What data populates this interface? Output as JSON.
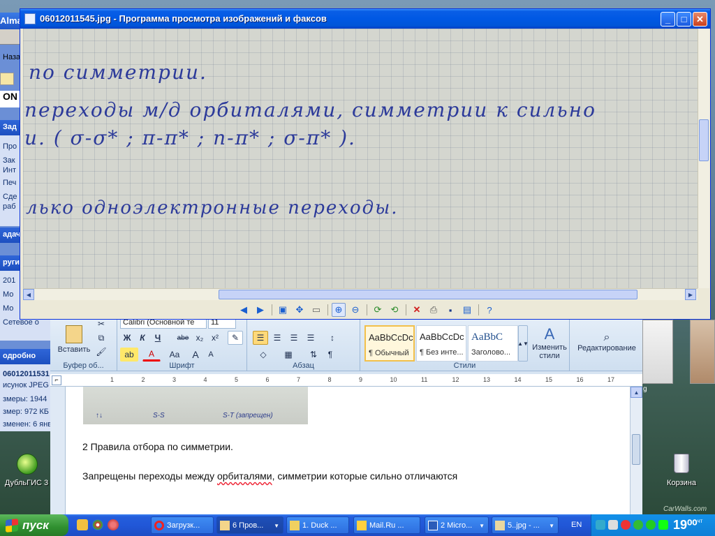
{
  "viewer": {
    "title": "06012011545.jpg - Программа просмотра изображений и факсов",
    "photo_lines": [
      "по симметрии.",
      "переходы м/д орбиталями, симметрии к сильно",
      "и. ( σ-σ* ; π-π* ; n-π* ; σ-π* ).",
      "лько одноэлектронные переходы."
    ]
  },
  "explorer": {
    "app_title": "Almap",
    "back_label": "Назад",
    "son": "ON",
    "tasks_header": "Зад",
    "task_items": [
      "Про",
      "Зак",
      "Инт",
      "Печ",
      "Сде",
      "раб"
    ],
    "tasks_header2": "адачи",
    "other_header": "ругие",
    "other_items": [
      "201",
      "Мо",
      "Мо",
      "Сетевое о"
    ],
    "detail_header": "одробно",
    "detail_name": "06012011531",
    "detail_type": "исунок JPEG",
    "detail_dims": "змеры: 1944",
    "detail_size": "змер: 972 КБ",
    "detail_changed": "зменен: 6 янв"
  },
  "word": {
    "ribbon": {
      "paste_label": "Вставить",
      "clipboard_group": "Буфер об...",
      "font_name": "Calibri (Основной те",
      "font_size": "11",
      "font_group": "Шрифт",
      "bold": "Ж",
      "italic": "К",
      "underline": "Ч",
      "strike": "abe",
      "subscript": "x₂",
      "superscript": "x²",
      "case": "Aa",
      "grow": "A",
      "shrink": "A",
      "paragraph_group": "Абзац",
      "styles_group": "Стили",
      "styles": [
        {
          "sample": "AaBbCcDc",
          "name": "¶ Обычный"
        },
        {
          "sample": "AaBbCcDc",
          "name": "¶ Без инте..."
        },
        {
          "sample": "AaBbC",
          "name": "Заголово..."
        }
      ],
      "change_styles": "Изменить стили",
      "editing": "Редактирование"
    },
    "ruler_marks": [
      "1",
      "2",
      "3",
      "4",
      "5",
      "6",
      "7",
      "8",
      "9",
      "10",
      "11",
      "12",
      "13",
      "14",
      "15",
      "16",
      "17"
    ],
    "snip_labels": [
      "S-S",
      "S-T (запрещен)"
    ],
    "doc_heading": "2 Правила отбора по симметрии.",
    "doc_line_before": "Запрещены переходы  между ",
    "doc_misspelled": "орбиталями",
    "doc_line_after": ", симметрии которые сильно отличаются"
  },
  "desktop": {
    "dubl_label": "ДубльГИС 3",
    "recycle_label": "Корзина",
    "watermark": "CarWalls.com",
    "thumb_caption": "g"
  },
  "taskbar": {
    "start_label": "пуск",
    "buttons": [
      {
        "label": "Загрузк..."
      },
      {
        "label": "6 Пров..."
      },
      {
        "label": "1. Duck ..."
      },
      {
        "label": "Mail.Ru ..."
      },
      {
        "label": "2 Micro..."
      },
      {
        "label": "5..jpg - ..."
      }
    ],
    "lang": "EN",
    "time": "19⁰⁰",
    "day": "чт"
  },
  "colors": {
    "xp_blue": "#0055d8",
    "start_green": "#2f8f2f",
    "ink": "#2c3a9a"
  }
}
